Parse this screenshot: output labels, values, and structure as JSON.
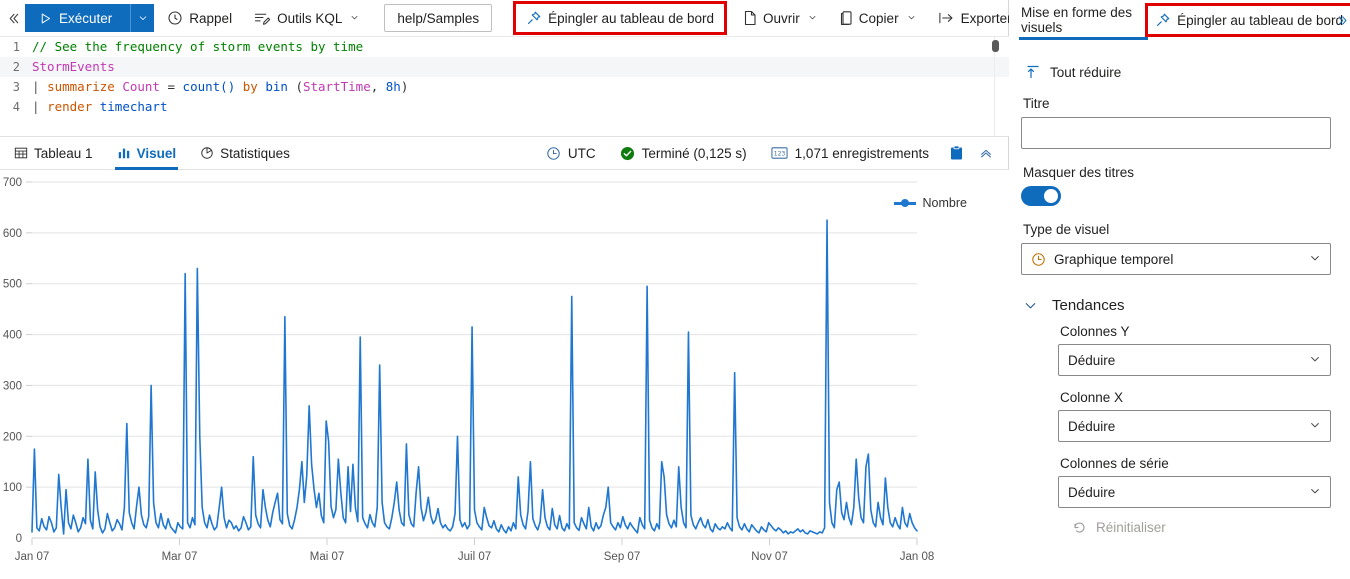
{
  "toolbar": {
    "collapse_icon": "chevron-double-left-icon",
    "run_label": "Exécuter",
    "run_caret_icon": "chevron-down-icon",
    "recall_label": "Rappel",
    "recall_icon": "recall-icon",
    "kql_tools_label": "Outils KQL",
    "kql_tools_icon": "kql-tools-icon",
    "samples_label": "help/Samples",
    "pin_label": "Épingler au tableau de bord",
    "pin_icon": "pin-icon",
    "open_label": "Ouvrir",
    "open_icon": "file-icon",
    "copy_label": "Copier",
    "copy_icon": "copy-icon",
    "export_label": "Exporter",
    "export_icon": "export-icon",
    "highlight_color": "#e00000",
    "accent_color": "#0f6cbd"
  },
  "editor": {
    "lines": [
      {
        "number": "1",
        "highlight": false,
        "tokens": [
          {
            "t": "// See the frequency of storm events by time",
            "c": "c-comment"
          }
        ]
      },
      {
        "number": "2",
        "highlight": true,
        "tokens": [
          {
            "t": "StormEvents",
            "c": "c-table"
          }
        ]
      },
      {
        "number": "3",
        "highlight": false,
        "tokens": [
          {
            "t": "| ",
            "c": "c-pipe"
          },
          {
            "t": "summarize ",
            "c": "c-kw"
          },
          {
            "t": "Count ",
            "c": "c-col"
          },
          {
            "t": "= ",
            "c": "c-op"
          },
          {
            "t": "count() ",
            "c": "c-func"
          },
          {
            "t": "by ",
            "c": "c-kw"
          },
          {
            "t": "bin ",
            "c": "c-func"
          },
          {
            "t": "(",
            "c": "c-op"
          },
          {
            "t": "StartTime",
            "c": "c-col"
          },
          {
            "t": ", ",
            "c": "c-op"
          },
          {
            "t": "8h",
            "c": "c-num"
          },
          {
            "t": ")",
            "c": "c-op"
          }
        ]
      },
      {
        "number": "4",
        "highlight": false,
        "tokens": [
          {
            "t": "| ",
            "c": "c-pipe"
          },
          {
            "t": "render ",
            "c": "c-kw"
          },
          {
            "t": "timechart",
            "c": "c-id"
          }
        ]
      }
    ]
  },
  "results": {
    "tabs": [
      {
        "label": "Tableau 1",
        "icon": "table-icon",
        "active": false
      },
      {
        "label": "Visuel",
        "icon": "chart-icon",
        "active": true
      },
      {
        "label": "Statistiques",
        "icon": "stats-icon",
        "active": false
      }
    ],
    "timezone": "UTC",
    "timezone_icon": "clock-icon",
    "status": "Terminé (0,125 s)",
    "status_icon": "check-circle-icon",
    "status_color": "#107c10",
    "records": "1,071 enregistrements",
    "records_icon": "numbers-icon",
    "clipboard_icon": "clipboard-icon",
    "collapse_icon": "chevron-up-icon"
  },
  "chart_data": {
    "type": "line",
    "title": "",
    "xlabel": "",
    "ylabel": "",
    "ylim": [
      0,
      700
    ],
    "yticks": [
      0,
      100,
      200,
      300,
      400,
      500,
      600,
      700
    ],
    "xticks": [
      "Jan 07",
      "Mar 07",
      "Mai 07",
      "Juil 07",
      "Sep 07",
      "Nov 07",
      "Jan 08"
    ],
    "grid": true,
    "legend": [
      "Nombre"
    ],
    "legend_position": "top-right",
    "series_color": "#1f77d0",
    "series": [
      {
        "name": "Nombre",
        "values": [
          12,
          175,
          20,
          14,
          38,
          22,
          16,
          42,
          30,
          12,
          20,
          125,
          60,
          8,
          95,
          30,
          18,
          45,
          30,
          12,
          20,
          40,
          28,
          155,
          35,
          18,
          130,
          55,
          22,
          10,
          18,
          48,
          30,
          14,
          20,
          36,
          28,
          16,
          60,
          225,
          50,
          30,
          18,
          62,
          100,
          45,
          26,
          20,
          42,
          300,
          70,
          30,
          20,
          48,
          26,
          18,
          38,
          22,
          16,
          10,
          30,
          22,
          18,
          520,
          30,
          20,
          40,
          26,
          530,
          200,
          60,
          30,
          20,
          45,
          28,
          16,
          22,
          60,
          100,
          40,
          20,
          35,
          30,
          18,
          24,
          14,
          20,
          42,
          30,
          16,
          22,
          160,
          45,
          28,
          20,
          95,
          60,
          35,
          22,
          50,
          70,
          88,
          36,
          28,
          435,
          48,
          24,
          18,
          36,
          60,
          96,
          150,
          70,
          122,
          260,
          145,
          96,
          60,
          88,
          44,
          30,
          230,
          190,
          62,
          40,
          56,
          155,
          90,
          40,
          30,
          140,
          52,
          145,
          60,
          32,
          395,
          40,
          28,
          20,
          46,
          30,
          22,
          60,
          340,
          70,
          30,
          22,
          18,
          40,
          70,
          110,
          55,
          30,
          24,
          185,
          46,
          28,
          22,
          90,
          140,
          60,
          34,
          50,
          80,
          44,
          28,
          36,
          58,
          30,
          20,
          26,
          18,
          14,
          22,
          48,
          200,
          36,
          22,
          30,
          18,
          26,
          415,
          55,
          30,
          22,
          16,
          60,
          40,
          24,
          20,
          34,
          18,
          12,
          26,
          16,
          10,
          22,
          14,
          30,
          18,
          120,
          45,
          26,
          18,
          52,
          150,
          38,
          24,
          16,
          32,
          95,
          40,
          22,
          16,
          58,
          26,
          18,
          44,
          20,
          14,
          28,
          18,
          475,
          30,
          20,
          15,
          40,
          28,
          18,
          60,
          22,
          14,
          30,
          18,
          24,
          45,
          60,
          100,
          30,
          22,
          16,
          30,
          20,
          42,
          26,
          18,
          30,
          22,
          16,
          10,
          40,
          26,
          18,
          495,
          35,
          20,
          14,
          28,
          18,
          150,
          120,
          46,
          28,
          20,
          35,
          22,
          140,
          60,
          30,
          20,
          405,
          45,
          26,
          18,
          30,
          40,
          26,
          20,
          36,
          18,
          12,
          28,
          20,
          16,
          22,
          18,
          30,
          20,
          14,
          325,
          40,
          22,
          16,
          28,
          18,
          12,
          26,
          20,
          14,
          10,
          22,
          16,
          12,
          30,
          24,
          18,
          14,
          20,
          16,
          10,
          14,
          8,
          12,
          10,
          14,
          18,
          12,
          16,
          10,
          8,
          14,
          12,
          10,
          8,
          12,
          10,
          20,
          625,
          70,
          30,
          20,
          95,
          110,
          50,
          36,
          70,
          40,
          26,
          60,
          155,
          80,
          40,
          30,
          140,
          165,
          55,
          30,
          22,
          70,
          40,
          26,
          118,
          60,
          30,
          22,
          40,
          26,
          18,
          60,
          30,
          22,
          48,
          30,
          20,
          14
        ]
      }
    ]
  },
  "visual_panel": {
    "tab_label": "Mise en forme des visuels",
    "pin_label": "Épingler au tableau de bord",
    "pin_icon": "pin-icon",
    "expand_icon": "chevron-double-right-icon",
    "collapse_all_label": "Tout réduire",
    "collapse_all_icon": "collapse-all-icon",
    "title_label": "Titre",
    "title_value": "",
    "title_placeholder": "",
    "hide_titles_label": "Masquer des titres",
    "hide_titles_on": true,
    "visual_type_label": "Type de visuel",
    "visual_type_value": "Graphique temporel",
    "visual_type_icon": "clock-icon",
    "trends": {
      "section_label": "Tendances",
      "section_icon": "chevron-down-icon",
      "y_columns_label": "Colonnes Y",
      "y_columns_value": "Déduire",
      "x_column_label": "Colonne X",
      "x_column_value": "Déduire",
      "series_columns_label": "Colonnes de série",
      "series_columns_value": "Déduire",
      "reset_label": "Réinitialiser",
      "reset_icon": "reset-icon"
    }
  }
}
